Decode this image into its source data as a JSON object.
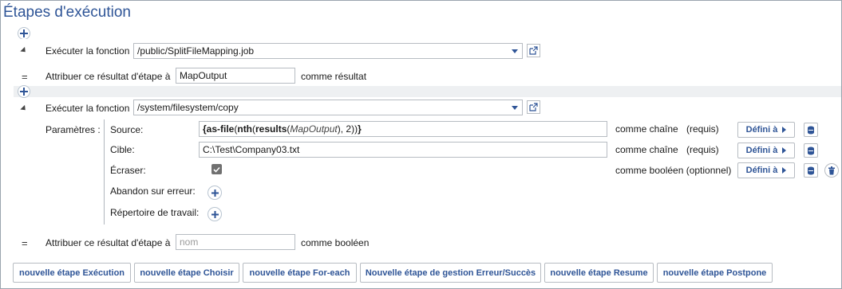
{
  "title": "Étapes d'exécution",
  "step1": {
    "label": "Exécuter la fonction",
    "function_value": "/public/SplitFileMapping.job",
    "assign_label": "Attribuer ce résultat d'étape à",
    "assign_value": "MapOutput",
    "assign_suffix": "comme résultat"
  },
  "step2": {
    "label": "Exécuter la fonction",
    "function_value": "/system/filesystem/copy",
    "params_label": "Paramètres :",
    "params": [
      {
        "name": "Source:",
        "expr": {
          "open": "{",
          "f1": "as-file",
          "p1": "(",
          "f2": "nth",
          "p2": "(",
          "f3": "results",
          "p3": "(",
          "arg": "MapOutput",
          "p4": "), 2))",
          "close": "}"
        },
        "type": "comme chaîne",
        "req": "(requis)",
        "btn": "Défini à"
      },
      {
        "name": "Cible:",
        "value": "C:\\Test\\Company03.txt",
        "type": "comme chaîne",
        "req": "(requis)",
        "btn": "Défini à"
      },
      {
        "name": "Écraser:",
        "checked": true,
        "type": "comme booléen (optionnel)",
        "btn": "Défini à"
      },
      {
        "name": "Abandon sur erreur:"
      },
      {
        "name": "Répertoire de travail:"
      }
    ],
    "assign_label": "Attribuer ce résultat d'étape à",
    "assign_placeholder": "nom",
    "assign_suffix": "comme booléen"
  },
  "footer_buttons": [
    "nouvelle étape Exécution",
    "nouvelle étape Choisir",
    "nouvelle étape For-each",
    "Nouvelle étape de gestion Erreur/Succès",
    "nouvelle étape Resume",
    "nouvelle étape Postpone"
  ],
  "colors": {
    "accent": "#2f5597",
    "band": "#eef0f2",
    "border": "#b7bcc2"
  }
}
